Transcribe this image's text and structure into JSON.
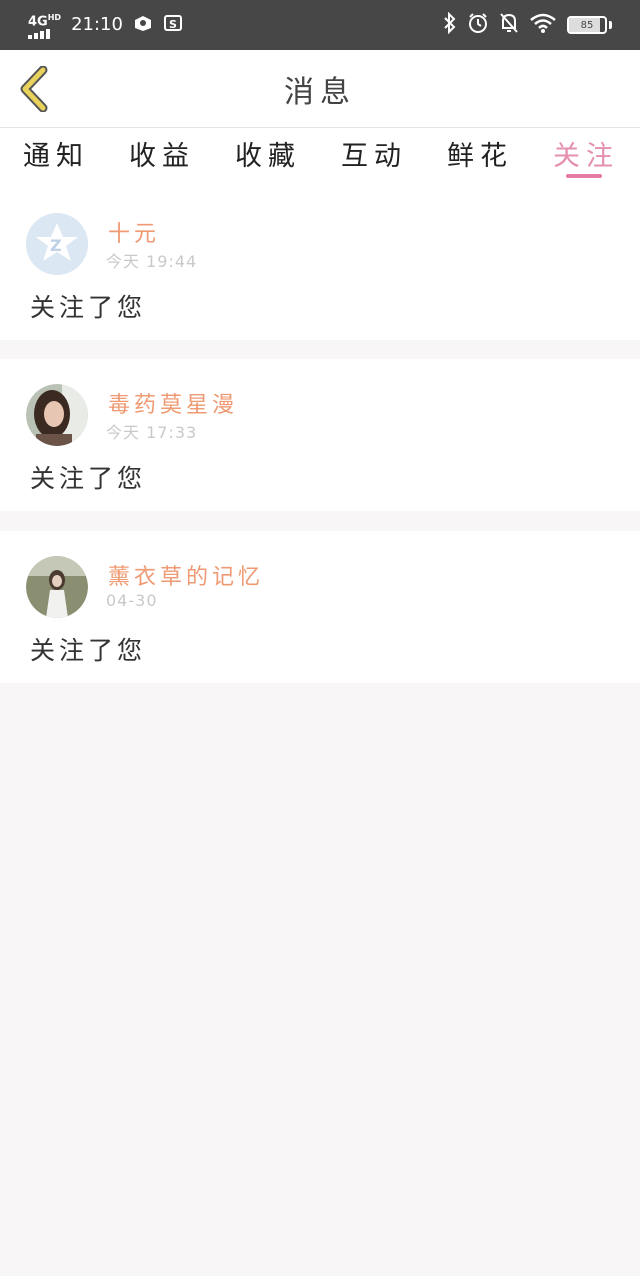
{
  "status_bar": {
    "network": "4G",
    "network_sub": "HD",
    "time": "21:10",
    "battery_level": "85"
  },
  "header": {
    "title": "消息"
  },
  "tabs": [
    {
      "label": "通知",
      "active": false
    },
    {
      "label": "收益",
      "active": false
    },
    {
      "label": "收藏",
      "active": false
    },
    {
      "label": "互动",
      "active": false
    },
    {
      "label": "鲜花",
      "active": false
    },
    {
      "label": "关注",
      "active": true
    }
  ],
  "notifications": [
    {
      "name": "十元",
      "time": "今天 19:44",
      "message": "关注了您",
      "avatar": "default-avatar"
    },
    {
      "name": "毒药莫星漫",
      "time": "今天 17:33",
      "message": "关注了您",
      "avatar": "user-photo"
    },
    {
      "name": "薰衣草的记忆",
      "time": "04-30",
      "message": "关注了您",
      "avatar": "user-photo"
    }
  ],
  "colors": {
    "accent": "#e57aa4",
    "username": "#ef9a72",
    "status_bar": "#474747",
    "back_icon": "#e8d25b"
  }
}
